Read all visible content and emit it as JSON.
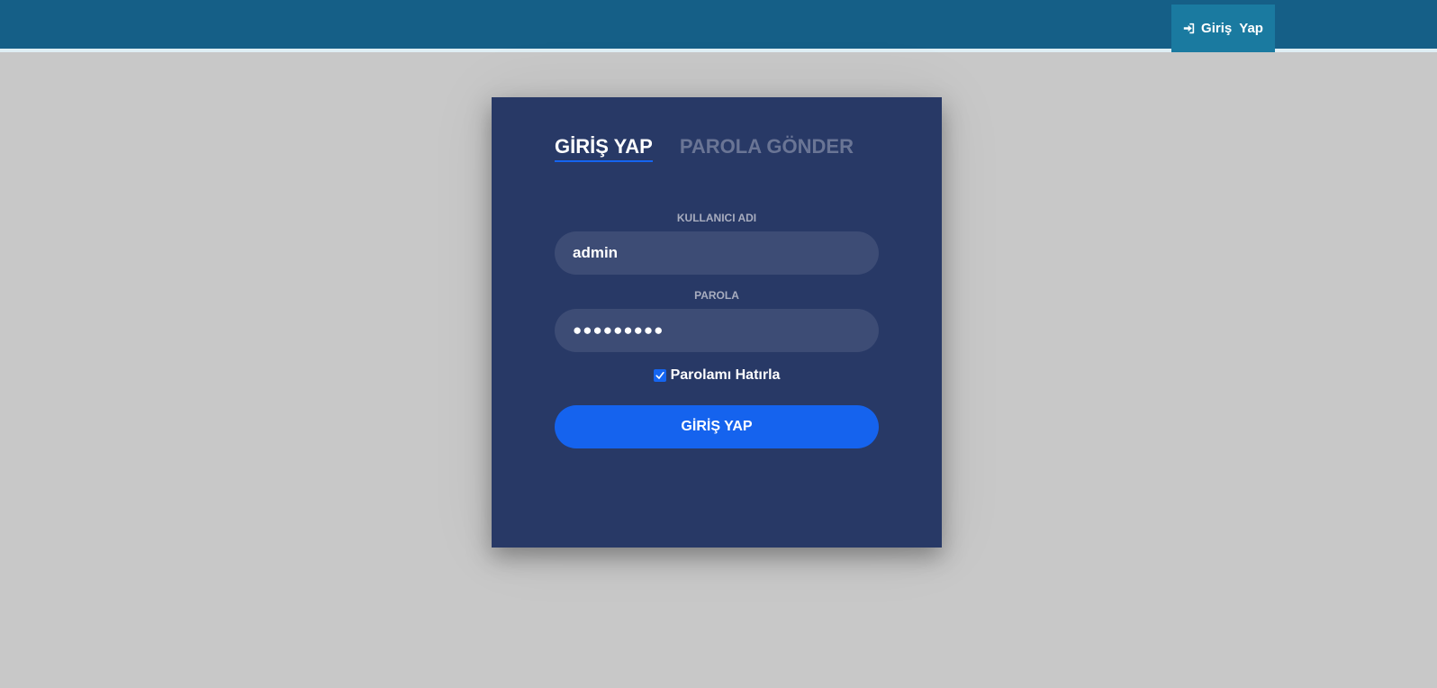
{
  "header": {
    "login_label": "Giriş  Yap",
    "login_icon": "sign-in-icon"
  },
  "colors": {
    "header_bg": "#155f87",
    "header_button_bg": "#1a7aa0",
    "page_bg": "#c8c8c8",
    "card_bg": "#283966",
    "input_bg": "#3d4c75",
    "accent": "#1565f0"
  },
  "login_card": {
    "tabs": [
      {
        "label": "GİRİŞ YAP",
        "active": true
      },
      {
        "label": "PAROLA GÖNDER",
        "active": false
      }
    ],
    "username": {
      "label": "KULLANICI ADI",
      "value": "admin"
    },
    "password": {
      "label": "PAROLA",
      "masked_value": "●●●●●●●●●"
    },
    "remember": {
      "label": "Parolamı Hatırla",
      "checked": true
    },
    "submit_label": "GİRİŞ YAP"
  }
}
